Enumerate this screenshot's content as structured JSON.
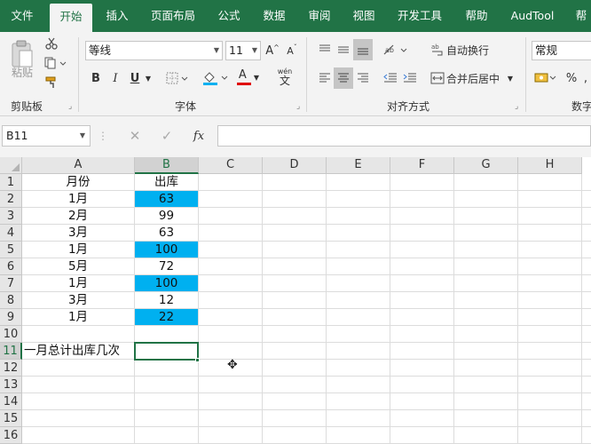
{
  "ribbon_tabs": [
    "文件",
    "开始",
    "插入",
    "页面布局",
    "公式",
    "数据",
    "审阅",
    "视图",
    "开发工具",
    "帮助",
    "AudTool",
    "帮"
  ],
  "active_tab_index": 1,
  "clipboard": {
    "paste_label": "粘贴",
    "group_label": "剪贴板"
  },
  "font": {
    "name": "等线",
    "size": "11",
    "grow_label": "A",
    "shrink_label": "A",
    "bold_label": "B",
    "italic_label": "I",
    "underline_label": "U",
    "font_color_label": "A",
    "phonetic_label": "wén",
    "phonetic_sub": "文",
    "group_label": "字体"
  },
  "alignment": {
    "wrap_text_label": "自动换行",
    "merge_center_label": "合并后居中",
    "group_label": "对齐方式"
  },
  "number": {
    "format_value": "常规",
    "percent_label": "%",
    "group_label": "数字"
  },
  "formula_bar": {
    "name_box": "B11",
    "fx_label": "fx",
    "formula": ""
  },
  "sheet": {
    "columns": [
      "A",
      "B",
      "C",
      "D",
      "E",
      "F",
      "G",
      "H"
    ],
    "rows": [
      "1",
      "2",
      "3",
      "4",
      "5",
      "6",
      "7",
      "8",
      "9",
      "10",
      "11",
      "12",
      "13",
      "14",
      "15",
      "16"
    ],
    "active_column": "B",
    "active_row": "11",
    "data": [
      {
        "a": "月份",
        "b": "出库",
        "hl": false
      },
      {
        "a": "1月",
        "b": "63",
        "hl": true
      },
      {
        "a": "2月",
        "b": "99",
        "hl": false
      },
      {
        "a": "3月",
        "b": "63",
        "hl": false
      },
      {
        "a": "1月",
        "b": "100",
        "hl": true
      },
      {
        "a": "5月",
        "b": "72",
        "hl": false
      },
      {
        "a": "1月",
        "b": "100",
        "hl": true
      },
      {
        "a": "3月",
        "b": "12",
        "hl": false
      },
      {
        "a": "1月",
        "b": "22",
        "hl": true
      }
    ],
    "a11_label": "一月总计出库几次",
    "highlight_color": "#00b0f0"
  },
  "colors": {
    "brand": "#217346"
  }
}
